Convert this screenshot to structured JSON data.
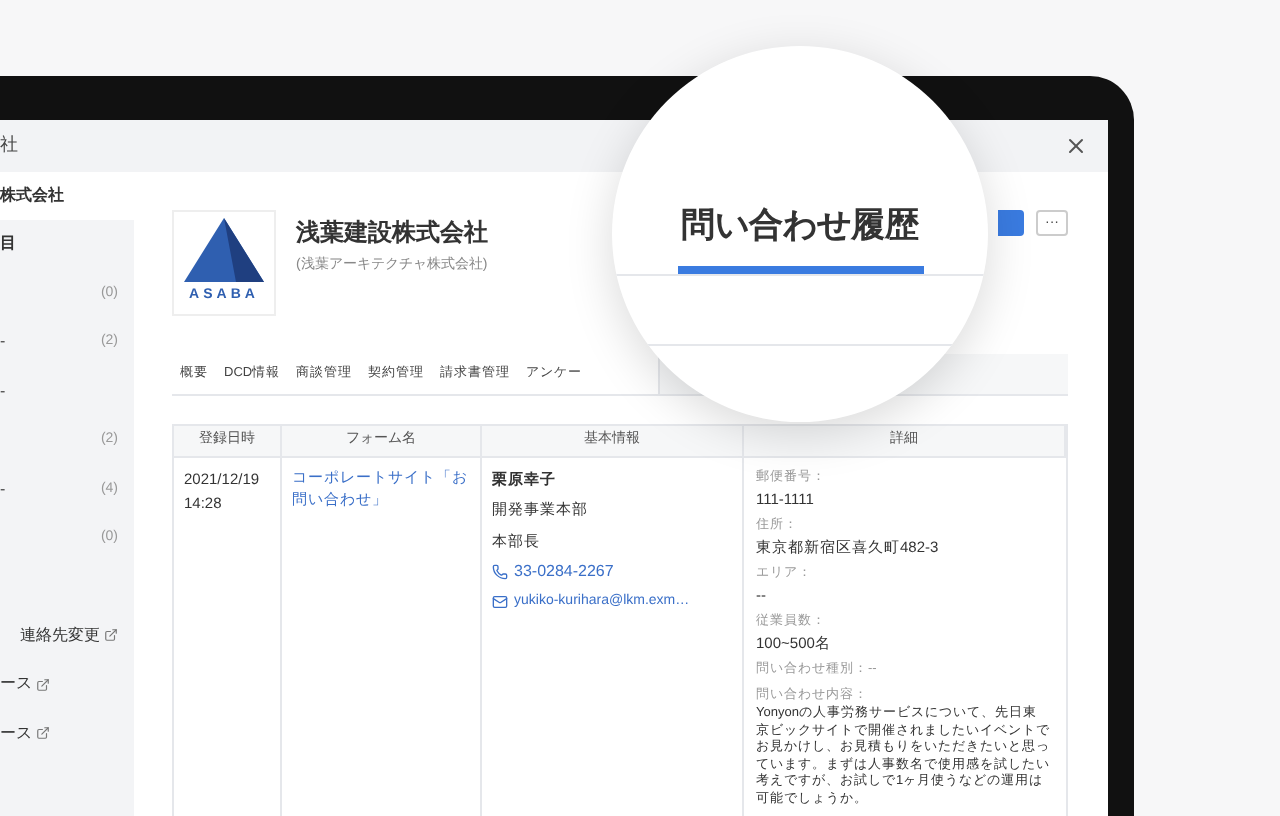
{
  "window": {
    "title": "社"
  },
  "sidebar": {
    "heading": "株式会社",
    "items": [
      {
        "label": "目"
      },
      {
        "count": "(0)"
      },
      {
        "label": "-",
        "count": "(2)"
      },
      {
        "label": "-"
      },
      {
        "count": "(2)"
      },
      {
        "label": "-",
        "count": "(4)"
      },
      {
        "count": "(0)"
      }
    ],
    "links": [
      "連絡先変更",
      "ース",
      "ース"
    ]
  },
  "company": {
    "name": "浅葉建設株式会社",
    "subname": "(浅葉アーキテクチャ株式会社)",
    "logo_text": "ASABA",
    "more_button": "···"
  },
  "tabs": [
    {
      "label": "概要",
      "selected": false
    },
    {
      "label": "DCD情報",
      "selected": false
    },
    {
      "label": "商談管理",
      "selected": false
    },
    {
      "label": "契約管理",
      "selected": false
    },
    {
      "label": "請求書管理",
      "selected": false
    },
    {
      "label": "アンケー",
      "selected": false
    }
  ],
  "magnifier": {
    "tab": {
      "label": "問い合わせ履歴",
      "selected": true
    }
  },
  "table": {
    "columns": [
      "登録日時",
      "フォーム名",
      "基本情報",
      "詳細"
    ],
    "rows": [
      {
        "date": "2021/12/19 14:28",
        "form": "コーポレートサイト「お問い合わせ」",
        "name": "栗原幸子",
        "department": "開発事業本部",
        "title": "本部長",
        "phone": "33-0284-2267",
        "email": "yukiko-kurihara@lkm.exm…",
        "details": [
          {
            "label": "郵便番号：",
            "value": "111-1111"
          },
          {
            "label": "住所：",
            "value": "東京都新宿区喜久町482-3"
          },
          {
            "label": "エリア：",
            "value": "--"
          },
          {
            "label": "従業員数：",
            "value": "100~500名"
          },
          {
            "label": "問い合わせ種別：--"
          },
          {
            "label": "問い合わせ内容：",
            "value": "Yonyonの人事労務サービスについて、先日東京ビックサイトで開催されましたいイベントでお見かけし、お見積もりをいただきたいと思っています。まずは人事数名で使用感を試したい考えですが、お試しで1ヶ月使うなどの運用は可能でしょうか。"
          }
        ]
      }
    ]
  }
}
